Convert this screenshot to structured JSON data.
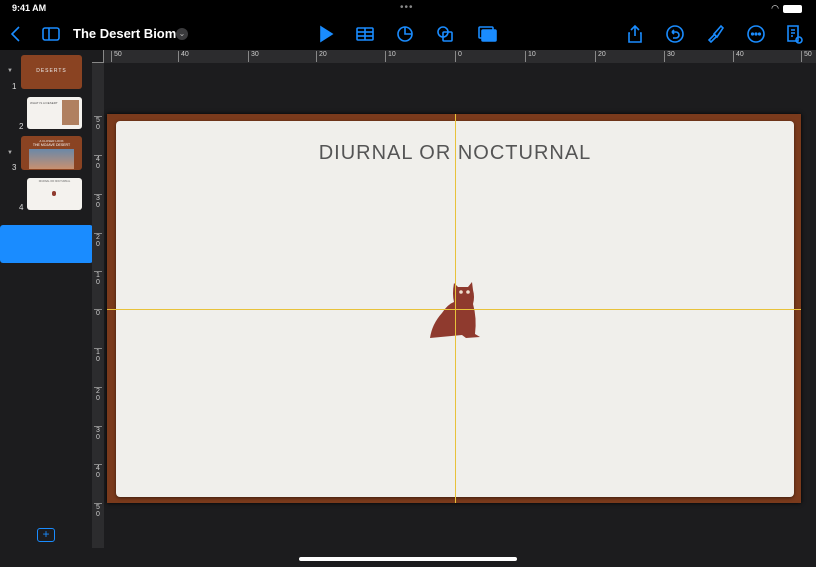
{
  "status": {
    "time": "9:41 AM"
  },
  "toolbar": {
    "title": "The Desert Biome"
  },
  "slides": [
    {
      "number": "1",
      "title": "DESERTS"
    },
    {
      "number": "2",
      "title": "WHAT IS A DESERT"
    },
    {
      "number": "3",
      "title": "THE MOJAVE DESERT",
      "subtitle": "A CLOSER LOOK"
    },
    {
      "number": "4",
      "title": "DIURNAL OR NOCTURNAL"
    }
  ],
  "slide": {
    "title": "DIURNAL OR NOCTURNAL"
  },
  "rulers": {
    "horizontal": [
      "50",
      "40",
      "30",
      "20",
      "10",
      "0",
      "10",
      "20",
      "30",
      "40",
      "50"
    ],
    "vertical": [
      "50",
      "40",
      "30",
      "20",
      "10",
      "0",
      "10",
      "20",
      "30",
      "40",
      "50"
    ]
  },
  "colors": {
    "accent": "#1a8cff",
    "frame": "#7a3a1c",
    "guide": "#e8c23a",
    "owl": "#8f3a2e"
  }
}
